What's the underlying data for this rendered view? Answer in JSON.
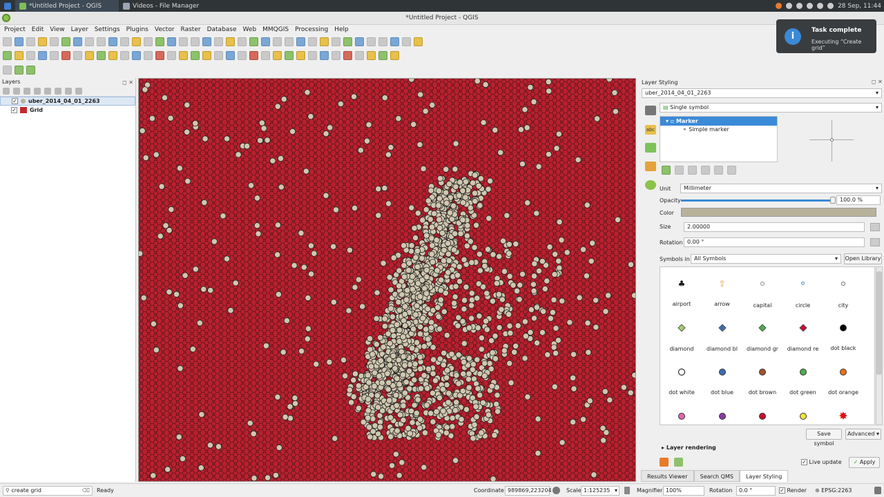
{
  "taskbar": {
    "apps": [
      {
        "label": "*Untitled Project - QGIS"
      },
      {
        "label": "Videos - File Manager"
      }
    ],
    "clock": "28 Sep, 11:44"
  },
  "window": {
    "title": "*Untitled Project - QGIS"
  },
  "menu": [
    "Project",
    "Edit",
    "View",
    "Layer",
    "Settings",
    "Plugins",
    "Vector",
    "Raster",
    "Database",
    "Web",
    "MMQGIS",
    "Processing",
    "Help"
  ],
  "layers_panel": {
    "title": "Layers",
    "items": [
      {
        "name": "uber_2014_04_01_2263",
        "checked": true,
        "swatch": "#b9b29a",
        "selected": true
      },
      {
        "name": "Grid",
        "checked": true,
        "swatch": "#c0272d",
        "selected": false
      }
    ]
  },
  "styling": {
    "title": "Layer Styling",
    "layer_select": "uber_2014_04_01_2263",
    "renderer": "Single symbol",
    "tree": {
      "root": "Marker",
      "child": "Simple marker"
    },
    "unit_label": "Unit",
    "unit_value": "Millimeter",
    "opacity_label": "Opacity",
    "opacity_value": "100.0 %",
    "opacity_level": 1.0,
    "color_label": "Color",
    "color_value": "#b9b29a",
    "size_label": "Size",
    "size_value": "2.00000",
    "rotation_label": "Rotation",
    "rotation_value": "0.00 °",
    "symbols_in_label": "Symbols in",
    "symbols_in_value": "All Symbols",
    "open_library": "Open Library",
    "save_symbol": "Save symbol",
    "advanced": "Advanced",
    "layer_rendering": "Layer rendering",
    "live_update": "Live update",
    "apply": "Apply",
    "symbols": [
      {
        "name": "airport",
        "shape": "airport",
        "color": "#111111"
      },
      {
        "name": "arrow",
        "shape": "arrow",
        "color": "#e0a030"
      },
      {
        "name": "capital",
        "shape": "ring",
        "color": "#888888"
      },
      {
        "name": "circle",
        "shape": "smalldot",
        "color": "#5a8fc8"
      },
      {
        "name": "city",
        "shape": "ring",
        "color": "#666666"
      },
      {
        "name": "diamond",
        "shape": "diamond",
        "color": "#a6d070"
      },
      {
        "name": "diamond bl",
        "shape": "diamond",
        "color": "#3c6db5"
      },
      {
        "name": "diamond gr",
        "shape": "diamond",
        "color": "#4cae4c"
      },
      {
        "name": "diamond re",
        "shape": "diamond",
        "color": "#c8102e"
      },
      {
        "name": "dot  black",
        "shape": "dot",
        "color": "#000000"
      },
      {
        "name": "dot  white",
        "shape": "dotring",
        "color": "#ffffff"
      },
      {
        "name": "dot blue",
        "shape": "dot",
        "color": "#3c6db5"
      },
      {
        "name": "dot brown",
        "shape": "dot",
        "color": "#a0522d"
      },
      {
        "name": "dot green",
        "shape": "dot",
        "color": "#4cae4c"
      },
      {
        "name": "dot orange",
        "shape": "dot",
        "color": "#e8711c"
      },
      {
        "name": "",
        "shape": "dot",
        "color": "#e066b0"
      },
      {
        "name": "",
        "shape": "dot",
        "color": "#8b3aa6"
      },
      {
        "name": "",
        "shape": "dot",
        "color": "#c8102e"
      },
      {
        "name": "",
        "shape": "dot",
        "color": "#f5e233"
      },
      {
        "name": "",
        "shape": "star",
        "color": "#e01010"
      }
    ]
  },
  "bottom_tabs": [
    "Results Viewer",
    "Search QMS",
    "Layer Styling"
  ],
  "status": {
    "search_value": "create grid",
    "ready": "Ready",
    "coordinate_label": "Coordinate",
    "coordinate_value": "989869,223204",
    "scale_label": "Scale",
    "scale_value": "1:125235",
    "magnifier_label": "Magnifier",
    "magnifier_value": "100%",
    "rotation_label": "Rotation",
    "rotation_value": "0.0 °",
    "render_label": "Render",
    "crs": "EPSG:2263"
  },
  "toast": {
    "title": "Task complete",
    "body": "Executing “Create grid”"
  },
  "colors": {
    "grid_fill": "#b8202e",
    "grid_line": "#3a1216",
    "point_fill": "#cfc7b0",
    "point_stroke": "#1e1e1e"
  }
}
